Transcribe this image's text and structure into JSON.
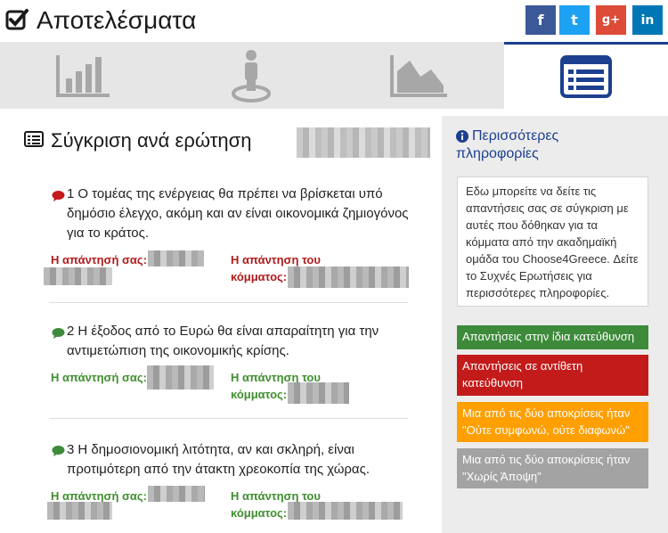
{
  "header": {
    "title": "Αποτελέσματα",
    "social": {
      "facebook": "f",
      "twitter": "t",
      "googleplus": "g+",
      "linkedin": "in"
    }
  },
  "tabs": [
    {
      "icon": "bar-chart-icon",
      "active": false
    },
    {
      "icon": "person-location-icon",
      "active": false
    },
    {
      "icon": "area-chart-icon",
      "active": false
    },
    {
      "icon": "list-icon",
      "active": true
    }
  ],
  "section": {
    "title": "Σύγκριση ανά ερώτηση"
  },
  "questions": [
    {
      "number": "1",
      "text": "Ο τομέας της ενέργειας θα πρέπει να βρίσκεται υπό δημόσιο έλεγχο, ακόμη και αν είναι οικονομικά ζημιογόνος για το κράτος.",
      "your_answer_label": "Η απάντησή σας:",
      "party_answer_label_1": "Η απάντηση του",
      "party_answer_label_2": "κόμματος:",
      "status": "opposite",
      "status_color": "#c31a1a"
    },
    {
      "number": "2",
      "text": "Η έξοδος από το Ευρώ θα είναι απαραίτητη για την αντιμετώπιση της οικονομικής κρίσης.",
      "your_answer_label": "Η απάντησή σας:",
      "party_answer_label_1": "Η απάντηση του",
      "party_answer_label_2": "κόμματος:",
      "status": "same",
      "status_color": "#3d8b3a"
    },
    {
      "number": "3",
      "text": "Η δημοσιονομική λιτότητα, αν και σκληρή, είναι προτιμότερη από την άτακτη χρεοκοπία της χώρας.",
      "your_answer_label": "Η απάντησή σας:",
      "party_answer_label_1": "Η απάντηση του",
      "party_answer_label_2": "κόμματος:",
      "status": "same",
      "status_color": "#3d8b3a"
    }
  ],
  "sidebar": {
    "title": "Περισσότερες πληροφορίες",
    "description": "Εδω μπορείτε να δείτε τις απαντήσεις σας σε σύγκριση με αυτές που δόθηκαν για τα κόμματα από την ακαδημαϊκή ομάδα του Choose4Greece. Δείτε το Συχνές Ερωτήσεις για περισσότερες πληροφορίες.",
    "legend": [
      {
        "label": "Απαντήσεις στην ίδια κατεύθυνση",
        "color": "#3d8b3a"
      },
      {
        "label": "Απαντήσεις σε αντίθετη κατεύθυνση",
        "color": "#c31a1a"
      },
      {
        "label": "Μια από τις δύο αποκρίσεις ήταν \"Ούτε συμφωνώ, ούτε διαφωνώ\"",
        "color": "#ff9f00"
      },
      {
        "label": "Μια από τις δύο αποκρίσεις ήταν \"Χωρίς Άποψη\"",
        "color": "#a3a3a3"
      }
    ]
  }
}
